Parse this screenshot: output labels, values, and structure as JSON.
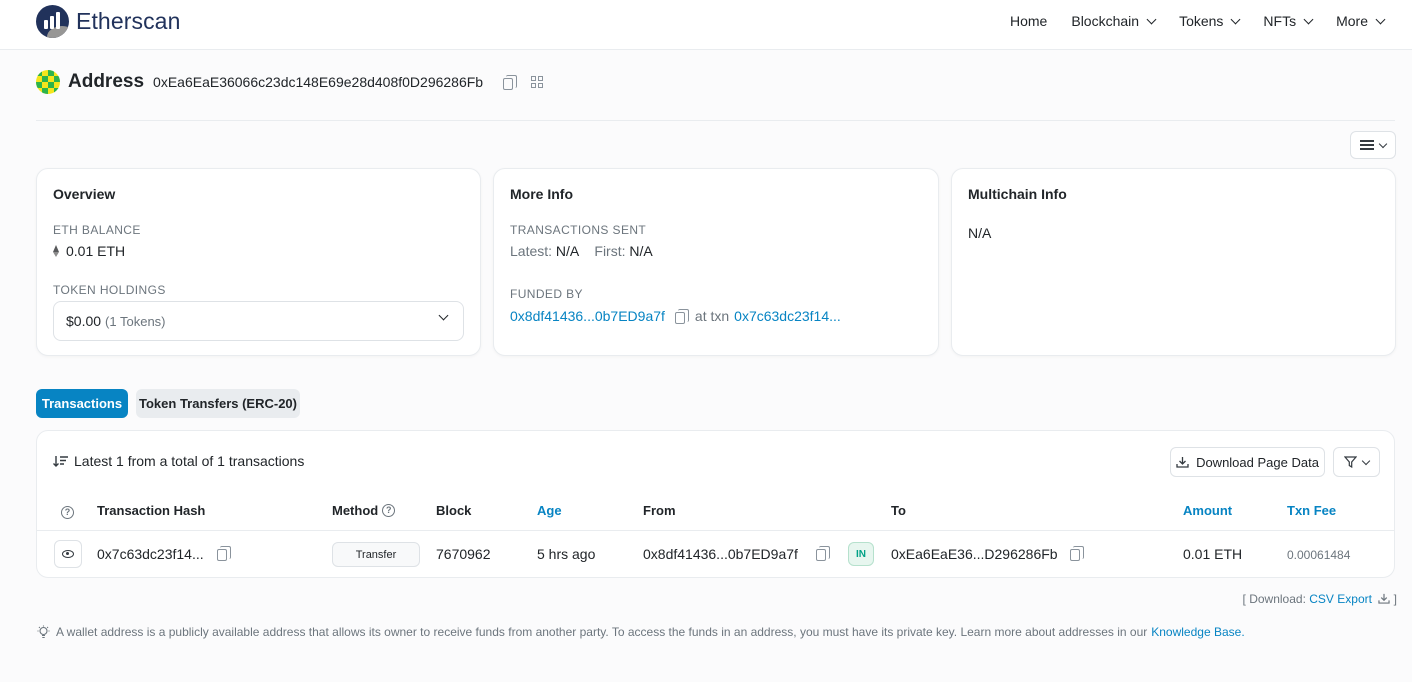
{
  "header": {
    "brand": "Etherscan",
    "nav": [
      "Home",
      "Blockchain",
      "Tokens",
      "NFTs",
      "More"
    ]
  },
  "address": {
    "label": "Address",
    "value": "0xEa6EaE36066c23dc148E69e28d408f0D296286Fb"
  },
  "overview": {
    "title": "Overview",
    "eth_balance_label": "ETH BALANCE",
    "eth_balance_value": "0.01 ETH",
    "token_holdings_label": "TOKEN HOLDINGS",
    "token_holdings_value": "$0.00",
    "token_holdings_count": "(1 Tokens)"
  },
  "more_info": {
    "title": "More Info",
    "tx_sent_label": "TRANSACTIONS SENT",
    "latest_label": "Latest:",
    "latest_value": "N/A",
    "first_label": "First:",
    "first_value": "N/A",
    "funded_by_label": "FUNDED BY",
    "funded_by_address": "0x8df41436...0b7ED9a7f",
    "at_txn_label": "at txn",
    "at_txn_value": "0x7c63dc23f14..."
  },
  "multichain": {
    "title": "Multichain Info",
    "value": "N/A"
  },
  "tabs": [
    "Transactions",
    "Token Transfers (ERC-20)"
  ],
  "transactions": {
    "summary": "Latest 1 from a total of 1 transactions",
    "download_button": "Download Page Data",
    "columns": [
      "Transaction Hash",
      "Method",
      "Block",
      "Age",
      "From",
      "To",
      "Amount",
      "Txn Fee"
    ],
    "rows": [
      {
        "hash": "0x7c63dc23f14...",
        "method": "Transfer",
        "block": "7670962",
        "age": "5 hrs ago",
        "from": "0x8df41436...0b7ED9a7f",
        "direction": "IN",
        "to": "0xEa6EaE36...D296286Fb",
        "amount": "0.01 ETH",
        "fee": "0.00061484"
      }
    ]
  },
  "download_line": {
    "prefix": "[ Download:",
    "link": "CSV Export",
    "suffix": "]"
  },
  "footnote": {
    "text": "A wallet address is a publicly available address that allows its owner to receive funds from another party. To access the funds in an address, you must have its private key. Learn more about addresses in our",
    "link": "Knowledge Base."
  },
  "colors": {
    "accent": "#0784c3",
    "brand_navy": "#21325b",
    "in_badge": "#00a186"
  }
}
